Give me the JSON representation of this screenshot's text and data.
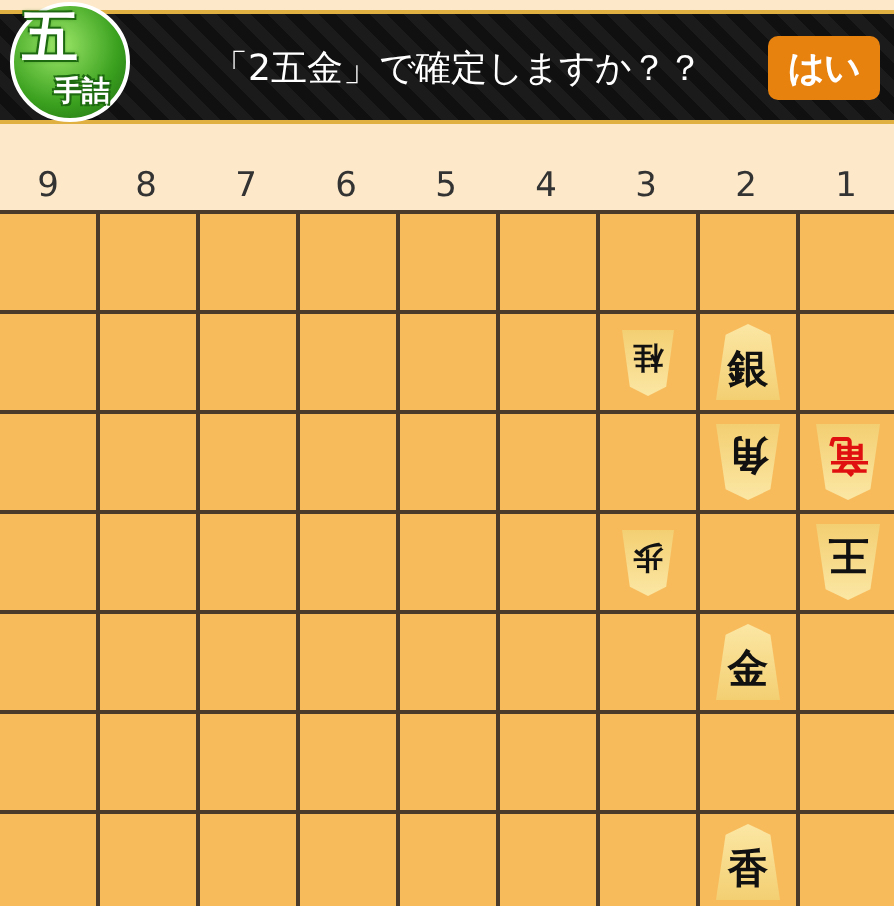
{
  "badge": {
    "number": "五",
    "label": "手詰"
  },
  "prompt": {
    "message": "「2五金」で確定しますか？？",
    "button": "はい"
  },
  "file_labels": [
    "9",
    "8",
    "7",
    "6",
    "5",
    "4",
    "3",
    "2",
    "1"
  ],
  "board": {
    "rows": [
      {
        "cells": [
          {},
          {},
          {},
          {},
          {},
          {},
          {},
          {},
          {}
        ]
      },
      {
        "cells": [
          {},
          {},
          {},
          {},
          {},
          {},
          {
            "piece": {
              "label": "桂",
              "opponent": true,
              "promoted": false,
              "small": true
            }
          },
          {
            "piece": {
              "label": "銀",
              "opponent": false,
              "promoted": false,
              "small": false
            }
          },
          {}
        ]
      },
      {
        "cells": [
          {},
          {},
          {},
          {},
          {},
          {},
          {},
          {
            "piece": {
              "label": "角",
              "opponent": true,
              "promoted": false,
              "small": false
            }
          },
          {
            "piece": {
              "label": "竜",
              "opponent": true,
              "promoted": true,
              "small": false
            }
          }
        ]
      },
      {
        "cells": [
          {},
          {},
          {},
          {},
          {},
          {},
          {
            "piece": {
              "label": "歩",
              "opponent": true,
              "promoted": false,
              "small": true
            }
          },
          {},
          {
            "piece": {
              "label": "王",
              "opponent": true,
              "promoted": false,
              "small": false
            }
          }
        ]
      },
      {
        "cells": [
          {},
          {},
          {},
          {},
          {},
          {},
          {},
          {
            "piece": {
              "label": "金",
              "opponent": false,
              "promoted": false,
              "small": false
            }
          },
          {}
        ]
      },
      {
        "cells": [
          {},
          {},
          {},
          {},
          {},
          {},
          {},
          {},
          {}
        ]
      },
      {
        "cells": [
          {},
          {},
          {},
          {},
          {},
          {},
          {},
          {
            "piece": {
              "label": "香",
              "opponent": false,
              "promoted": false,
              "small": false
            }
          },
          {}
        ]
      }
    ]
  }
}
